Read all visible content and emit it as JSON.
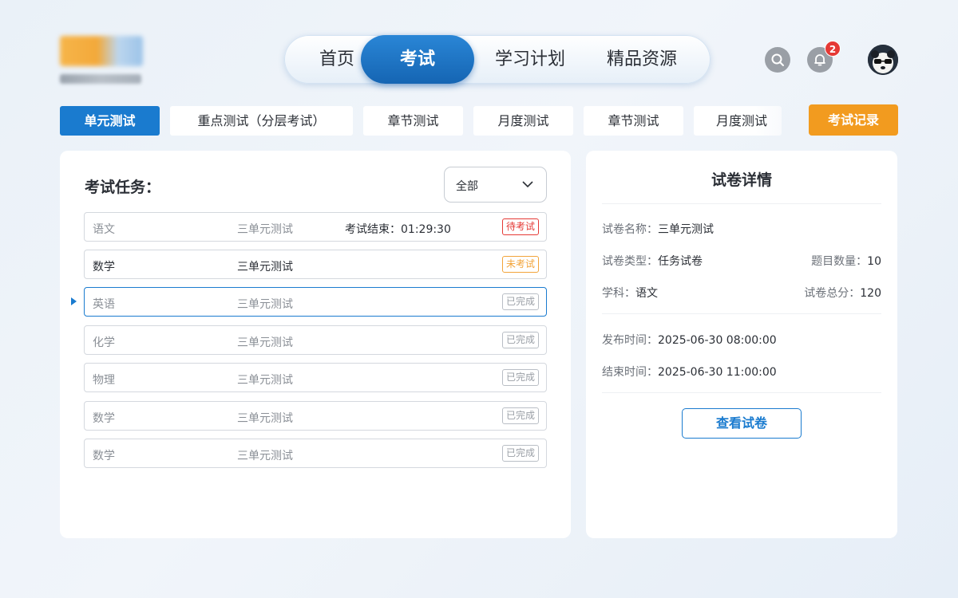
{
  "nav": {
    "items": [
      {
        "label": "首页"
      },
      {
        "label": "考试"
      },
      {
        "label": "学习计划"
      },
      {
        "label": "精品资源"
      }
    ],
    "active_index": 1
  },
  "header": {
    "notification_count": "2"
  },
  "categories": [
    {
      "label": "单元测试"
    },
    {
      "label": "重点测试（分层考试）"
    },
    {
      "label": "章节测试"
    },
    {
      "label": "月度测试"
    },
    {
      "label": "章节测试"
    },
    {
      "label": "月度测试"
    }
  ],
  "record_button": "考试记录",
  "tasks": {
    "title": "考试任务：",
    "filter": {
      "selected": "全部"
    },
    "rows": [
      {
        "subject": "语文",
        "exam": "三单元测试",
        "timer": "考试结束：01:29:30",
        "status": "待考试"
      },
      {
        "subject": "数学",
        "exam": "三单元测试",
        "timer": "",
        "status": "未考试"
      },
      {
        "subject": "英语",
        "exam": "三单元测试",
        "timer": "",
        "status": "已完成"
      },
      {
        "subject": "化学",
        "exam": "三单元测试",
        "timer": "",
        "status": "已完成"
      },
      {
        "subject": "物理",
        "exam": "三单元测试",
        "timer": "",
        "status": "已完成"
      },
      {
        "subject": "数学",
        "exam": "三单元测试",
        "timer": "",
        "status": "已完成"
      },
      {
        "subject": "数学",
        "exam": "三单元测试",
        "timer": "",
        "status": "已完成"
      }
    ]
  },
  "detail": {
    "title": "试卷详情",
    "name_label": "试卷名称：",
    "name_value": "三单元测试",
    "type_label": "试卷类型：",
    "type_value": "任务试卷",
    "count_label": "题目数量：",
    "count_value": "10",
    "subject_label": "学科：",
    "subject_value": "语文",
    "score_label": "试卷总分：",
    "score_value": "120",
    "publish_label": "发布时间：",
    "publish_value": "2025-06-30 08:00:00",
    "end_label": "结束时间：",
    "end_value": "2025-06-30 11:00:00",
    "view_button": "查看试卷"
  },
  "colors": {
    "primary": "#1a7bcf",
    "accent": "#f29b1f",
    "pending": "#e53935",
    "notyet": "#f2a43a"
  }
}
